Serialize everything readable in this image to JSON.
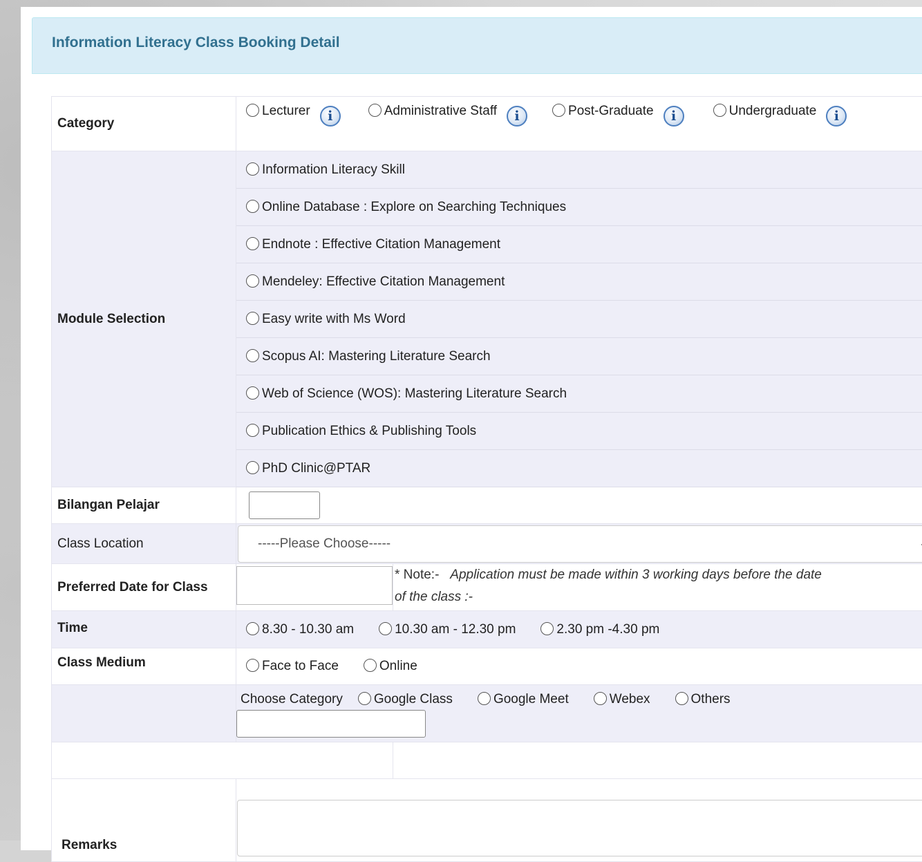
{
  "panel": {
    "title": "Information Literacy Class Booking Detail"
  },
  "category": {
    "label": "Category",
    "options": [
      "Lecturer",
      "Administrative Staff",
      "Post-Graduate",
      "Undergraduate"
    ],
    "info_icon": "info-icon"
  },
  "module": {
    "label": "Module Selection",
    "options": [
      "Information Literacy Skill",
      "Online Database : Explore on Searching Techniques",
      "Endnote : Effective Citation Management",
      "Mendeley: Effective Citation Management",
      "Easy write with Ms Word",
      "Scopus AI: Mastering Literature Search",
      "Web of Science (WOS): Mastering Literature Search",
      "Publication Ethics & Publishing Tools",
      "PhD Clinic@PTAR"
    ]
  },
  "students": {
    "label": "Bilangan Pelajar",
    "value": ""
  },
  "location": {
    "label": "Class Location",
    "selected": "-----Please Choose-----"
  },
  "date": {
    "label": "Preferred Date for Class",
    "value": "",
    "note_prefix": "* Note:-",
    "note_text": "Application must be made within 3 working days before the date",
    "note_text2": "of the class :-"
  },
  "time": {
    "label": "Time",
    "options": [
      "8.30 - 10.30 am",
      "10.30 am - 12.30 pm",
      "2.30 pm -4.30 pm"
    ]
  },
  "medium": {
    "label": "Class Medium",
    "options": [
      "Face to Face",
      "Online"
    ]
  },
  "platform": {
    "label": "Choose Category",
    "options": [
      "Google Class",
      "Google Meet",
      "Webex",
      "Others"
    ],
    "other_value": ""
  },
  "remarks": {
    "label": "Remarks",
    "value": ""
  },
  "colors": {
    "heading_bg": "#d9edf7",
    "heading_text": "#31708f",
    "row_alt": "#eeeef8",
    "info_icon": "#4d7fbf"
  }
}
